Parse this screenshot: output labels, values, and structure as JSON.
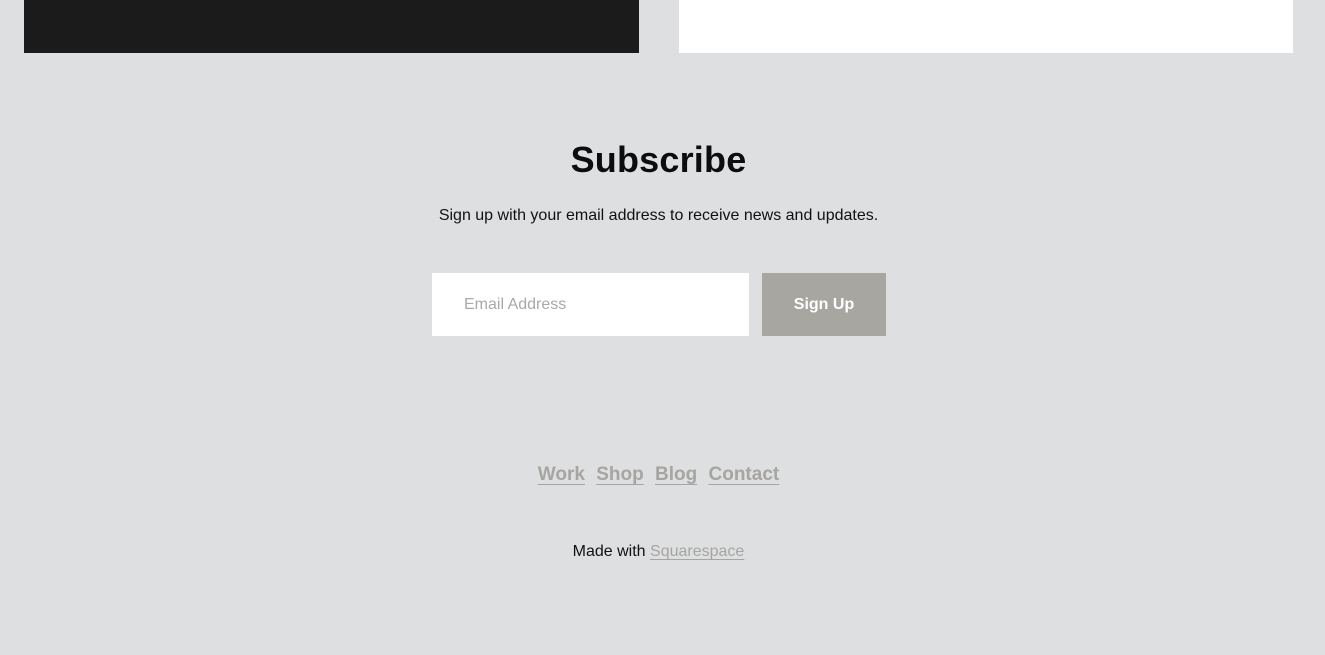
{
  "subscribe": {
    "title": "Subscribe",
    "description": "Sign up with your email address to receive news and updates.",
    "email_placeholder": "Email Address",
    "email_value": "",
    "button_label": "Sign Up"
  },
  "footer": {
    "nav": [
      {
        "label": "Work"
      },
      {
        "label": "Shop"
      },
      {
        "label": "Blog"
      },
      {
        "label": "Contact"
      }
    ],
    "made_with_prefix": "Made with ",
    "made_with_link": "Squarespace"
  },
  "colors": {
    "background": "#dedfe0",
    "dark_panel": "#1b1b1b",
    "light_panel": "#ffffff",
    "button": "#a7a6a1",
    "link": "#a6a5a1"
  }
}
